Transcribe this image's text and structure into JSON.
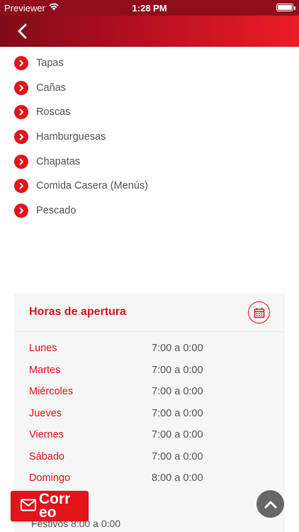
{
  "status_bar": {
    "carrier": "Previewer",
    "time": "1:28 PM"
  },
  "nav": {
    "back_icon": "chevron-left-icon"
  },
  "menu": {
    "items": [
      {
        "label": "Tapas"
      },
      {
        "label": "Cañas"
      },
      {
        "label": "Roscas"
      },
      {
        "label": "Hamburguesas"
      },
      {
        "label": "Chapatas"
      },
      {
        "label": "Comida Casera (Menús)"
      },
      {
        "label": "Pescado"
      }
    ]
  },
  "hours": {
    "title": "Horas de apertura",
    "icon": "calendar-icon",
    "rows": [
      {
        "day": "Lunes",
        "time": "7:00 a 0:00"
      },
      {
        "day": "Martes",
        "time": "7:00 a 0:00"
      },
      {
        "day": "Miércoles",
        "time": "7:00 a 0:00"
      },
      {
        "day": "Jueves",
        "time": "7:00 a 0:00"
      },
      {
        "day": "Viernes",
        "time": "7:00 a 0:00"
      },
      {
        "day": "Sábado",
        "time": "7:00 a 0:00"
      },
      {
        "day": "Domingo",
        "time": "8:00 a 0:00"
      }
    ],
    "festivos": "Festivos 8:00 a 0:00"
  },
  "mail_button": {
    "label": "Correo",
    "icon": "envelope-icon"
  },
  "scroll_top": {
    "icon": "chevron-up-icon"
  },
  "colors": {
    "accent": "#e3141b",
    "nav_dark": "#7e0b18",
    "nav_light": "#ec1c24",
    "card_bg": "#f6f6f6",
    "text": "#555555"
  }
}
